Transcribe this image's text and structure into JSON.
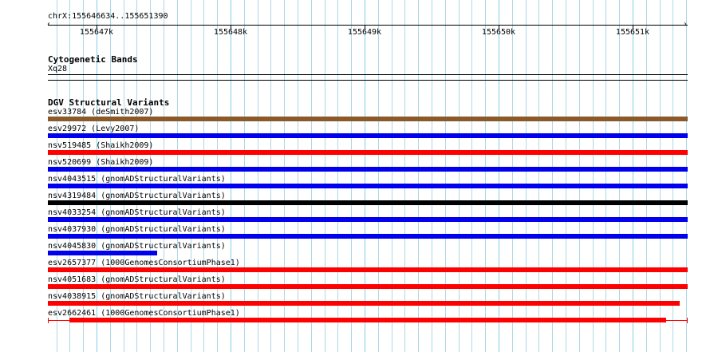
{
  "ruler": {
    "location": "chrX:155646634..155651390",
    "ticks": [
      "155647k",
      "155648k",
      "155649k",
      "155650k",
      "155651k"
    ]
  },
  "cytoband_track": {
    "title": "Cytogenetic Bands",
    "band": "Xq28"
  },
  "dgv_track": {
    "title": "DGV Structural Variants",
    "features": [
      {
        "label": "esv33784 (deSmith2007)",
        "color": "#8b5a2b"
      },
      {
        "label": "esv29972 (Levy2007)",
        "color": "#0000ee"
      },
      {
        "label": "nsv519485 (Shaikh2009)",
        "color": "#ff0000"
      },
      {
        "label": "nsv520699 (Shaikh2009)",
        "color": "#0000ee"
      },
      {
        "label": "nsv4043515 (gnomADStructuralVariants)",
        "color": "#0000ee"
      },
      {
        "label": "nsv4319484 (gnomADStructuralVariants)",
        "color": "#000000"
      },
      {
        "label": "nsv4033254 (gnomADStructuralVariants)",
        "color": "#0000ee"
      },
      {
        "label": "nsv4037930 (gnomADStructuralVariants)",
        "color": "#0000ee"
      },
      {
        "label": "nsv4045830 (gnomADStructuralVariants)",
        "color": "#0000ee"
      },
      {
        "label": "esv2657377 (1000GenomesConsortiumPhase1)",
        "color": "#ff0000"
      },
      {
        "label": "nsv4051683 (gnomADStructuralVariants)",
        "color": "#ff0000"
      },
      {
        "label": "nsv4038915 (gnomADStructuralVariants)",
        "color": "#ff0000"
      },
      {
        "label": "esv2662461 (1000GenomesConsortiumPhase1)",
        "color": "#ff0000"
      }
    ]
  },
  "colors": {
    "grid_minor": "#add8e6",
    "grid_major": "#87ceeb"
  }
}
